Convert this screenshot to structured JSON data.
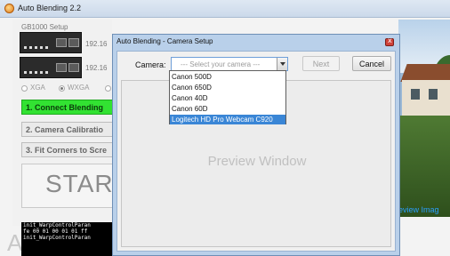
{
  "window": {
    "title": "Auto Blending 2.2",
    "icon": "app-logo-icon"
  },
  "left_panel": {
    "device_name": "GB1000 Setup",
    "ip_1": "192.16",
    "ip_2": "192.16",
    "resolution_options": [
      "XGA",
      "WXGA"
    ],
    "selected_resolution": "WXGA",
    "steps": [
      "1. Connect Blending",
      "2. Camera Calibratio",
      "3. Fit Corners to Scre"
    ],
    "active_step": 0,
    "start_label": "STAR",
    "big_letter": "A",
    "console_lines": [
      "init_WarpControlParan",
      "",
      "fe 00 01 00 01 01 ff",
      "init_WarpControlParan"
    ]
  },
  "right_panel": {
    "preview_label": "eview Imag"
  },
  "dialog": {
    "title": "Auto Blending - Camera Setup",
    "camera_label": "Camera:",
    "select_placeholder": "--- Select your camera ---",
    "next_label": "Next",
    "cancel_label": "Cancel",
    "preview_text": "Preview Window",
    "camera_options": [
      "Canon 500D",
      "Canon 650D",
      "Canon 40D",
      "Canon 60D",
      "Logitech HD Pro Webcam C920"
    ],
    "highlighted_option": 4
  },
  "colors": {
    "active_step": "#32e232",
    "dropdown_highlight": "#3a86d6",
    "preview_label": "#2aa0ff",
    "titlebar": "#cbd9ea"
  }
}
